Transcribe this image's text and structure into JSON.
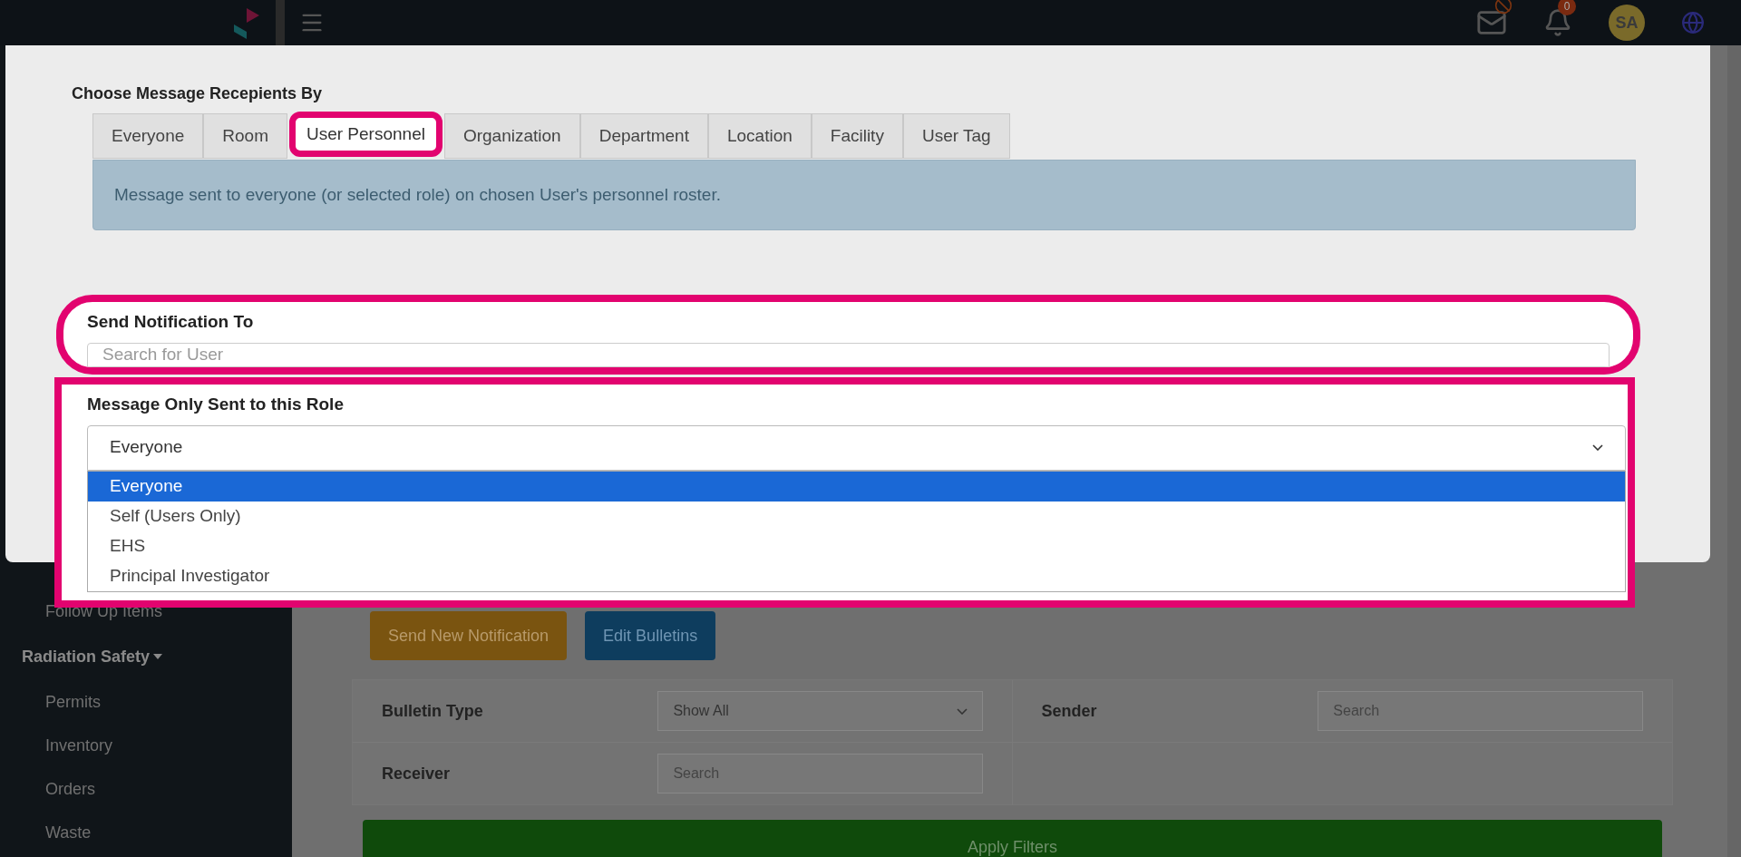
{
  "top_bar": {
    "notification_count": "0",
    "avatar_initials": "SA"
  },
  "sidebar": {
    "items": [
      {
        "label": "Follow Up Items",
        "kind": "link"
      },
      {
        "label": "Radiation Safety",
        "kind": "section"
      },
      {
        "label": "Permits",
        "kind": "link"
      },
      {
        "label": "Inventory",
        "kind": "link"
      },
      {
        "label": "Orders",
        "kind": "link"
      },
      {
        "label": "Waste",
        "kind": "link"
      }
    ]
  },
  "page": {
    "buttons": [
      {
        "label": "Send New Notification",
        "kind": "orange"
      },
      {
        "label": "Edit Bulletins",
        "kind": "blue"
      }
    ],
    "filters": {
      "bulletin_type_label": "Bulletin Type",
      "bulletin_type_value": "Show All",
      "sender_label": "Sender",
      "sender_placeholder": "Search",
      "receiver_label": "Receiver",
      "receiver_placeholder": "Search"
    },
    "apply_button": "Apply Filters"
  },
  "modal": {
    "title": "Choose Message Recepients By",
    "tabs": [
      {
        "label": "Everyone",
        "selected": false
      },
      {
        "label": "Room",
        "selected": false
      },
      {
        "label": "User Personnel",
        "selected": true
      },
      {
        "label": "Organization",
        "selected": false
      },
      {
        "label": "Department",
        "selected": false
      },
      {
        "label": "Location",
        "selected": false
      },
      {
        "label": "Facility",
        "selected": false
      },
      {
        "label": "User Tag",
        "selected": false
      }
    ],
    "info": "Message sent to everyone (or selected role) on chosen User's personnel roster.",
    "send_to": {
      "label": "Send Notification To",
      "placeholder": "Search for User"
    },
    "role": {
      "label": "Message Only Sent to this Role",
      "value": "Everyone",
      "options": [
        {
          "label": "Everyone",
          "selected": true
        },
        {
          "label": "Self (Users Only)",
          "selected": false
        },
        {
          "label": "EHS",
          "selected": false
        },
        {
          "label": "Principal Investigator",
          "selected": false
        }
      ]
    }
  }
}
